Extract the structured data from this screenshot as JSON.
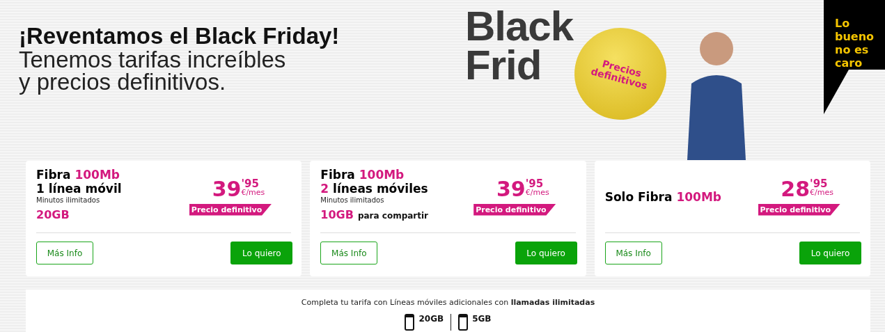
{
  "headline": {
    "title": "¡Reventamos el Black Friday!",
    "subtitle_lines": [
      "Tenemos tarifas increíbles",
      "y precios definitivos."
    ]
  },
  "banner": {
    "word_lines": [
      "Black",
      "Frid"
    ],
    "ball_text_lines": [
      "Precios",
      "definitivos"
    ],
    "tag_lines": [
      "Lo",
      "bueno",
      "no es",
      "caro"
    ]
  },
  "plans": [
    {
      "title_lines": [
        [
          {
            "text": "Fibra ",
            "highlight": false
          },
          {
            "text": "100Mb",
            "highlight": true
          }
        ],
        [
          {
            "text": "1 línea móvil",
            "highlight": false
          }
        ]
      ],
      "minutes": "Minutos ilimitados",
      "data": "20GB",
      "price_int": "39",
      "price_dec": "'95",
      "price_unit": "€/mes",
      "badge": "Precio definitivo",
      "info_button": "Más Info",
      "buy_button": "Lo quiero"
    },
    {
      "title_lines": [
        [
          {
            "text": "Fibra ",
            "highlight": false
          },
          {
            "text": "100Mb",
            "highlight": true
          }
        ],
        [
          {
            "text": "2",
            "highlight": true
          },
          {
            "text": " líneas móviles",
            "highlight": false
          }
        ]
      ],
      "minutes": "Minutos ilimitados",
      "data": "10GB",
      "data_note": "para compartir",
      "price_int": "39",
      "price_dec": "'95",
      "price_unit": "€/mes",
      "badge": "Precio definitivo",
      "info_button": "Más Info",
      "buy_button": "Lo quiero"
    },
    {
      "title_lines": [
        [
          {
            "text": "Solo Fibra ",
            "highlight": false
          },
          {
            "text": "100Mb",
            "highlight": true
          }
        ]
      ],
      "price_int": "28",
      "price_dec": "'95",
      "price_unit": "€/mes",
      "badge": "Precio definitivo",
      "info_button": "Más Info",
      "buy_button": "Lo quiero"
    }
  ],
  "extras": {
    "text": "Completa tu tarifa con Líneas móviles adicionales con **llamadas ilimitadas**",
    "options": [
      {
        "data": "20GB"
      },
      {
        "data": "5GB"
      }
    ]
  }
}
